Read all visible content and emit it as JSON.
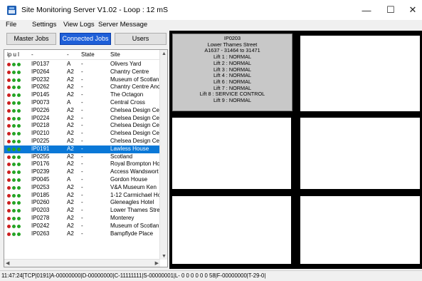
{
  "window": {
    "title": "Site Monitoring Server V1.02 - Loop : 12 mS",
    "minimize": "—",
    "maximize": "☐",
    "close": "✕"
  },
  "menu": [
    "File",
    "Settings",
    "View Logs",
    "Server Message"
  ],
  "tabs": [
    {
      "label": "Master Jobs",
      "active": false
    },
    {
      "label": "Connected Jobs",
      "active": true
    },
    {
      "label": "Users",
      "active": false
    }
  ],
  "list": {
    "columns": [
      "ip u l",
      "-",
      "-",
      "State",
      "Site"
    ],
    "rows": [
      {
        "dots": [
          "r",
          "g",
          "g"
        ],
        "id": "IP0137",
        "type": "A",
        "state": "-",
        "site": "Olivers Yard"
      },
      {
        "dots": [
          "r",
          "g",
          "g"
        ],
        "id": "IP0264",
        "type": "A2",
        "state": "-",
        "site": "Chantry Centre"
      },
      {
        "dots": [
          "r",
          "g",
          "g"
        ],
        "id": "IP0232",
        "type": "A2",
        "state": "-",
        "site": "Museum of Scotlan"
      },
      {
        "dots": [
          "r",
          "g",
          "g"
        ],
        "id": "IP0262",
        "type": "A2",
        "state": "-",
        "site": "Chantry Centre Anc"
      },
      {
        "dots": [
          "r",
          "g",
          "g"
        ],
        "id": "IP0145",
        "type": "A2",
        "state": "-",
        "site": "The Octagon"
      },
      {
        "dots": [
          "r",
          "g",
          "g"
        ],
        "id": "IP0073",
        "type": "A",
        "state": "-",
        "site": "Central Cross"
      },
      {
        "dots": [
          "r",
          "g",
          "g"
        ],
        "id": "IP0226",
        "type": "A2",
        "state": "-",
        "site": "Chelsea Design Ce"
      },
      {
        "dots": [
          "r",
          "g",
          "g"
        ],
        "id": "IP0224",
        "type": "A2",
        "state": "-",
        "site": "Chelsea Design Ce"
      },
      {
        "dots": [
          "r",
          "g",
          "g"
        ],
        "id": "IP0218",
        "type": "A2",
        "state": "-",
        "site": "Chelsea Design Ce"
      },
      {
        "dots": [
          "r",
          "g",
          "g"
        ],
        "id": "IP0210",
        "type": "A2",
        "state": "-",
        "site": "Chelsea Design Ce"
      },
      {
        "dots": [
          "r",
          "g",
          "g"
        ],
        "id": "IP0225",
        "type": "A2",
        "state": "-",
        "site": "Chelsea Design Ce"
      },
      {
        "dots": [
          "g",
          "g",
          "g"
        ],
        "id": "IP0191",
        "type": "A2",
        "state": "-",
        "site": "Lawless House",
        "selected": true
      },
      {
        "dots": [
          "r",
          "g",
          "g"
        ],
        "id": "IP0255",
        "type": "A2",
        "state": "-",
        "site": "Scotland"
      },
      {
        "dots": [
          "r",
          "g",
          "g"
        ],
        "id": "IP0176",
        "type": "A2",
        "state": "-",
        "site": "Royal Brompton Hc"
      },
      {
        "dots": [
          "r",
          "g",
          "g"
        ],
        "id": "IP0239",
        "type": "A2",
        "state": "-",
        "site": "Access Wandswort"
      },
      {
        "dots": [
          "r",
          "g",
          "g"
        ],
        "id": "IP0045",
        "type": "A",
        "state": "-",
        "site": "Gordon House"
      },
      {
        "dots": [
          "r",
          "g",
          "g"
        ],
        "id": "IP0253",
        "type": "A2",
        "state": "-",
        "site": "V&A Museum Ken"
      },
      {
        "dots": [
          "r",
          "g",
          "g"
        ],
        "id": "IP0185",
        "type": "A2",
        "state": "-",
        "site": "1-12 Carmichael Hc"
      },
      {
        "dots": [
          "r",
          "g",
          "g"
        ],
        "id": "IP0260",
        "type": "A2",
        "state": "-",
        "site": "Gleneagles Hotel"
      },
      {
        "dots": [
          "r",
          "g",
          "g"
        ],
        "id": "IP0203",
        "type": "A2",
        "state": "-",
        "site": "Lower Thames Stre"
      },
      {
        "dots": [
          "r",
          "g",
          "g"
        ],
        "id": "IP0278",
        "type": "A2",
        "state": "-",
        "site": "Monterey"
      },
      {
        "dots": [
          "r",
          "g",
          "g"
        ],
        "id": "IP0242",
        "type": "A2",
        "state": "-",
        "site": "Museum of Scotlan"
      },
      {
        "dots": [
          "r",
          "g",
          "g"
        ],
        "id": "IP0263",
        "type": "A2",
        "state": "-",
        "site": "Bampflyde Place"
      }
    ]
  },
  "info_panel": {
    "lines": [
      "IP0203",
      "Lower Thames Street",
      "A1637 - 31464 to 31471",
      "Lift 1 : NORMAL",
      "Lift 2 : NORMAL",
      "Lift 3 : NORMAL",
      "Lift 4 : NORMAL",
      "Lift 6 : NORMAL",
      "Lift 7 : NORMAL",
      "Lift 8 : SERVICE CONTROL",
      "Lift 9 : NORMAL"
    ]
  },
  "status_bar": "11:47:24[TCP|0191]A-00000000|D-00000000|C-11111111|S-00000001|L-  0  0  0  0  0  0  58|F-00000000|T-29-0|",
  "colors": {
    "dot_red": "#cc1f1f",
    "dot_green": "#25a425",
    "selected": "#0a78d7",
    "tab_active": "#1e5fd8"
  }
}
